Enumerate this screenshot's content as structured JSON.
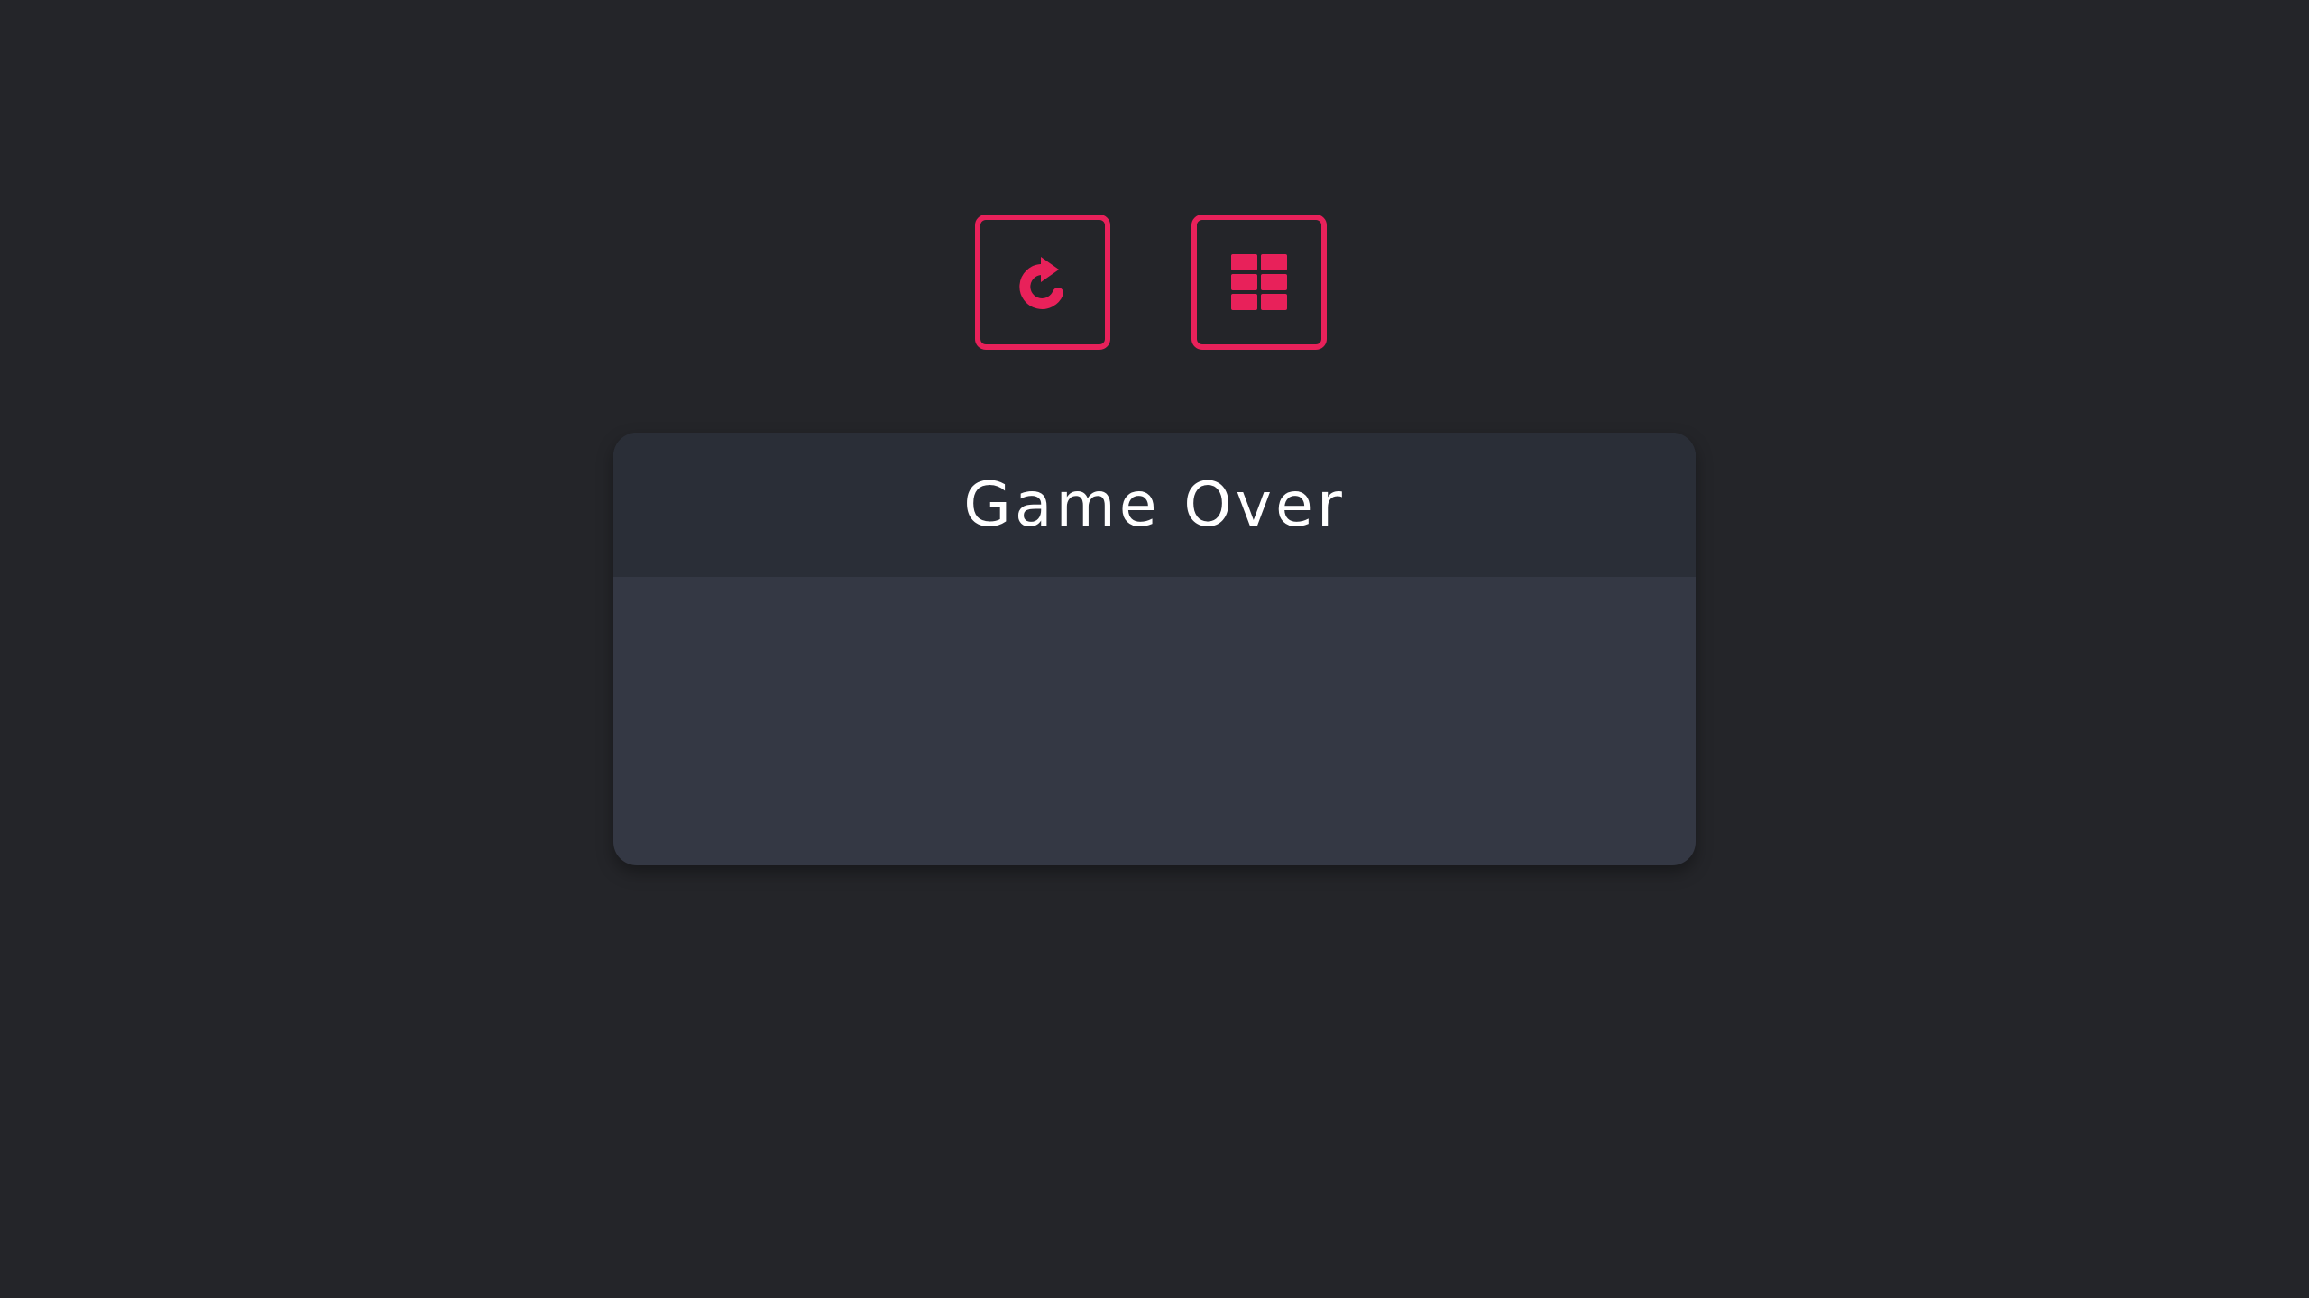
{
  "dialog": {
    "title": "Game Over"
  },
  "actions": [
    {
      "icon": "restart-icon"
    },
    {
      "icon": "level-grid-icon"
    }
  ],
  "colors": {
    "background": "#242529",
    "header": "#2a2e37",
    "body": "#343844",
    "accent": "#e8215a",
    "title": "#ffffff"
  }
}
